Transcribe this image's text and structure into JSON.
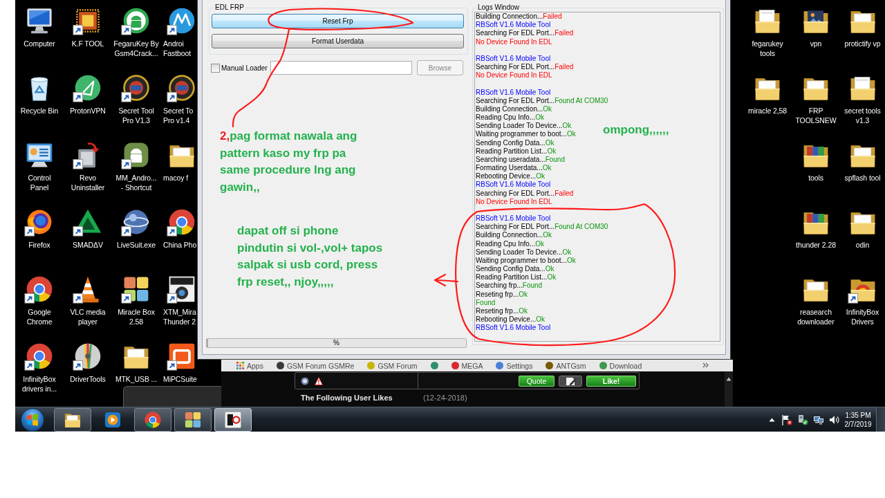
{
  "desktop": {
    "left_columns": [
      [
        {
          "label": "Computer",
          "kind": "computer",
          "shortcut": false
        },
        {
          "label": "Recycle Bin",
          "kind": "recycle",
          "shortcut": false
        },
        {
          "label": "Control\nPanel",
          "kind": "control",
          "shortcut": false
        },
        {
          "label": "Firefox",
          "kind": "firefox",
          "shortcut": true
        },
        {
          "label": "Google\nChrome",
          "kind": "chrome",
          "shortcut": true
        },
        {
          "label": "InfinityBox\ndrivers in...",
          "kind": "chrome",
          "shortcut": true
        }
      ],
      [
        {
          "label": "K.F TOOL",
          "kind": "chip",
          "shortcut": true
        },
        {
          "label": "ProtonVPN",
          "kind": "proton",
          "shortcut": true
        },
        {
          "label": "Revo\nUninstaller",
          "kind": "revo",
          "shortcut": true
        },
        {
          "label": "SMADΔV",
          "kind": "smadav",
          "shortcut": true
        },
        {
          "label": "VLC media\nplayer",
          "kind": "vlc",
          "shortcut": true
        },
        {
          "label": "DriverTools",
          "kind": "disc",
          "shortcut": true
        }
      ],
      [
        {
          "label": "FegaruKey By\nGsm4Crack...",
          "kind": "android",
          "shortcut": true
        },
        {
          "label": "Secret Tool\nPro V1.3",
          "kind": "seal",
          "shortcut": true
        },
        {
          "label": "MM_Andro...\n- Shortcut",
          "kind": "droid",
          "shortcut": true
        },
        {
          "label": "LiveSuit.exe",
          "kind": "globe",
          "shortcut": true
        },
        {
          "label": "Miracle Box\n2.58",
          "kind": "amt",
          "shortcut": true
        },
        {
          "label": "MTK_USB ...",
          "kind": "folder",
          "shortcut": false
        }
      ],
      [
        {
          "label": "Androi\nFastboot",
          "kind": "motorola",
          "shortcut": true
        },
        {
          "label": "Secret To\nPro v1.4",
          "kind": "seal",
          "shortcut": true
        },
        {
          "label": "macoy f",
          "kind": "folder",
          "shortcut": false
        },
        {
          "label": "China Pho",
          "kind": "chrome",
          "shortcut": true
        },
        {
          "label": "XTM_Mira\nThunder 2",
          "kind": "xtm",
          "shortcut": true
        },
        {
          "label": "MiPCSuite",
          "kind": "mi",
          "shortcut": true
        }
      ]
    ],
    "right_columns": [
      [
        {
          "label": "fegarukey\ntools",
          "kind": "papers",
          "shortcut": false
        },
        {
          "label": "miracle 2,58",
          "kind": "folder",
          "shortcut": false
        }
      ],
      [
        {
          "label": "vpn",
          "kind": "album",
          "shortcut": false
        },
        {
          "label": "FRP\nTOOLSNEW",
          "kind": "folder",
          "shortcut": false
        },
        {
          "label": "tools",
          "kind": "archive",
          "shortcut": false
        },
        {
          "label": "thunder 2.28",
          "kind": "archive",
          "shortcut": false
        },
        {
          "label": "reasearch\ndownloader",
          "kind": "folder",
          "shortcut": false
        }
      ],
      [
        {
          "label": "protictify vp",
          "kind": "folder",
          "shortcut": false
        },
        {
          "label": "secret tools\nv1.3",
          "kind": "papers",
          "shortcut": false
        },
        {
          "label": "spflash tool",
          "kind": "folder",
          "shortcut": false
        },
        {
          "label": "odin",
          "kind": "folder",
          "shortcut": false
        },
        {
          "label": "InfinityBox\nDrivers",
          "kind": "drivers",
          "shortcut": true
        }
      ]
    ]
  },
  "app_window": {
    "edl_group": {
      "title": "EDL FRP",
      "buttons": [
        {
          "label": "Reset Frp",
          "focused": true
        },
        {
          "label": "Format Userdata",
          "focused": false
        }
      ]
    },
    "manual_loader": {
      "label": "Manual Loader",
      "checked": false
    },
    "browse_button": {
      "label": "Browse",
      "disabled": true
    },
    "progress": {
      "label": "%",
      "level": 0
    },
    "logs": {
      "title": "Logs Window",
      "blocks": [
        [
          {
            "parts": [
              {
                "text": "Building Connection...",
                "kind": "plain"
              },
              {
                "text": "Failed",
                "kind": "error"
              }
            ]
          },
          {
            "parts": [
              {
                "text": "RBSoft V1.6 Mobile Tool",
                "kind": "title"
              }
            ]
          },
          {
            "parts": [
              {
                "text": "Searching For EDL Port...",
                "kind": "plain"
              },
              {
                "text": "Failed",
                "kind": "error"
              }
            ]
          },
          {
            "parts": [
              {
                "text": "No Device Found In EDL",
                "kind": "error"
              }
            ]
          }
        ],
        [
          {
            "parts": [
              {
                "text": "RBSoft V1.6 Mobile Tool",
                "kind": "title"
              }
            ]
          },
          {
            "parts": [
              {
                "text": "Searching For EDL Port...",
                "kind": "plain"
              },
              {
                "text": "Failed",
                "kind": "error"
              }
            ]
          },
          {
            "parts": [
              {
                "text": "No Device Found In EDL",
                "kind": "error"
              }
            ]
          }
        ],
        [
          {
            "parts": [
              {
                "text": "RBSoft V1.6 Mobile Tool",
                "kind": "title"
              }
            ]
          },
          {
            "parts": [
              {
                "text": "Searching For EDL Port...",
                "kind": "plain"
              },
              {
                "text": "Found At COM30",
                "kind": "success"
              }
            ]
          },
          {
            "parts": [
              {
                "text": "Building Connection...",
                "kind": "plain"
              },
              {
                "text": "Ok",
                "kind": "success"
              }
            ]
          },
          {
            "parts": [
              {
                "text": "Reading Cpu Info...",
                "kind": "plain"
              },
              {
                "text": "Ok",
                "kind": "success"
              }
            ]
          },
          {
            "parts": [
              {
                "text": "Sending Loader To Device...",
                "kind": "plain"
              },
              {
                "text": "Ok",
                "kind": "success"
              }
            ]
          },
          {
            "parts": [
              {
                "text": "Waiting programmer to boot...",
                "kind": "plain"
              },
              {
                "text": "Ok",
                "kind": "success"
              }
            ]
          },
          {
            "parts": [
              {
                "text": "Sending Config Data...",
                "kind": "plain"
              },
              {
                "text": "Ok",
                "kind": "success"
              }
            ]
          },
          {
            "parts": [
              {
                "text": "Reading Partition List...",
                "kind": "plain"
              },
              {
                "text": "Ok",
                "kind": "success"
              }
            ]
          },
          {
            "parts": [
              {
                "text": "Searching useradata...",
                "kind": "plain"
              },
              {
                "text": "Found",
                "kind": "success"
              }
            ]
          },
          {
            "parts": [
              {
                "text": "Formating Userdata...",
                "kind": "plain"
              },
              {
                "text": "Ok",
                "kind": "success"
              }
            ]
          },
          {
            "parts": [
              {
                "text": "Rebooting Device...",
                "kind": "plain"
              },
              {
                "text": "Ok",
                "kind": "success"
              }
            ]
          },
          {
            "parts": [
              {
                "text": "RBSoft V1.6 Mobile Tool",
                "kind": "title"
              }
            ]
          },
          {
            "parts": [
              {
                "text": "Searching For EDL Port...",
                "kind": "plain"
              },
              {
                "text": "Failed",
                "kind": "error"
              }
            ]
          },
          {
            "parts": [
              {
                "text": "No Device Found In EDL",
                "kind": "error"
              }
            ]
          }
        ],
        [
          {
            "parts": [
              {
                "text": "RBSoft V1.6 Mobile Tool",
                "kind": "title"
              }
            ]
          },
          {
            "parts": [
              {
                "text": "Searching For EDL Port...",
                "kind": "plain"
              },
              {
                "text": "Found At COM30",
                "kind": "success"
              }
            ]
          },
          {
            "parts": [
              {
                "text": "Building Connection...",
                "kind": "plain"
              },
              {
                "text": "Ok",
                "kind": "success"
              }
            ]
          },
          {
            "parts": [
              {
                "text": "Reading Cpu Info...",
                "kind": "plain"
              },
              {
                "text": "Ok",
                "kind": "success"
              }
            ]
          },
          {
            "parts": [
              {
                "text": "Sending Loader To Device...",
                "kind": "plain"
              },
              {
                "text": "Ok",
                "kind": "success"
              }
            ]
          },
          {
            "parts": [
              {
                "text": "Waiting programmer to boot...",
                "kind": "plain"
              },
              {
                "text": "Ok",
                "kind": "success"
              }
            ]
          },
          {
            "parts": [
              {
                "text": "Sending Config Data...",
                "kind": "plain"
              },
              {
                "text": "Ok",
                "kind": "success"
              }
            ]
          },
          {
            "parts": [
              {
                "text": "Reading Partition List...",
                "kind": "plain"
              },
              {
                "text": "Ok",
                "kind": "success"
              }
            ]
          },
          {
            "parts": [
              {
                "text": "Searching frp...",
                "kind": "plain"
              },
              {
                "text": "Found",
                "kind": "success"
              }
            ]
          },
          {
            "parts": [
              {
                "text": "Reseting frp...",
                "kind": "plain"
              },
              {
                "text": "Ok",
                "kind": "success"
              }
            ]
          },
          {
            "parts": [
              {
                "text": "Found",
                "kind": "success"
              }
            ]
          },
          {
            "parts": [
              {
                "text": "Reseting frp...",
                "kind": "plain"
              },
              {
                "text": "Ok",
                "kind": "success"
              }
            ]
          },
          {
            "parts": [
              {
                "text": "Rebooting Device...",
                "kind": "plain"
              },
              {
                "text": "Ok",
                "kind": "success"
              }
            ]
          },
          {
            "parts": [
              {
                "text": "RBSoft V1.6 Mobile Tool",
                "kind": "title"
              }
            ]
          }
        ]
      ]
    }
  },
  "annotations": [
    {
      "marker": "2,",
      "text": "pag format nawala ang pattern kaso my frp pa same procedure lng ang gawin,,"
    },
    {
      "text": "dapat off si phone pindutin si vol-,vol+ tapos salpak si usb cord, press frp reset,, njoy,,,,,"
    },
    {
      "text": "ompong,,,,,,"
    }
  ],
  "browser": {
    "bookmarks": [
      {
        "label": "Apps",
        "kind": "apps"
      },
      {
        "label": "GSM Forum GSMRe",
        "kind": "site",
        "color": "#3a3a3a"
      },
      {
        "label": "GSM Forum",
        "kind": "site",
        "color": "#c9b400"
      },
      {
        "kind": "site",
        "color": "#2f8f6a"
      },
      {
        "label": "MEGA",
        "kind": "site",
        "color": "#d9272e"
      },
      {
        "label": "Settings",
        "kind": "site",
        "color": "#4a7fd6"
      },
      {
        "label": "ANTGsm",
        "kind": "site",
        "color": "#7a5a00"
      },
      {
        "label": "Download",
        "kind": "site",
        "color": "#3d9a4f"
      }
    ],
    "quote_button": "Quote",
    "like_button": "Like!",
    "likes_heading": "The Following User Likes",
    "likes_date": "(12-24-2018)"
  },
  "taskbar": {
    "apps": [
      {
        "kind": "explorer",
        "running": true,
        "selected": false
      },
      {
        "kind": "media",
        "running": false,
        "selected": false
      },
      {
        "kind": "chrome",
        "running": true,
        "selected": false
      },
      {
        "kind": "amt",
        "running": true,
        "selected": false
      },
      {
        "kind": "r3",
        "running": true,
        "selected": true
      }
    ],
    "clock": {
      "time": "1:35 PM",
      "date": "2/7/2019"
    }
  }
}
